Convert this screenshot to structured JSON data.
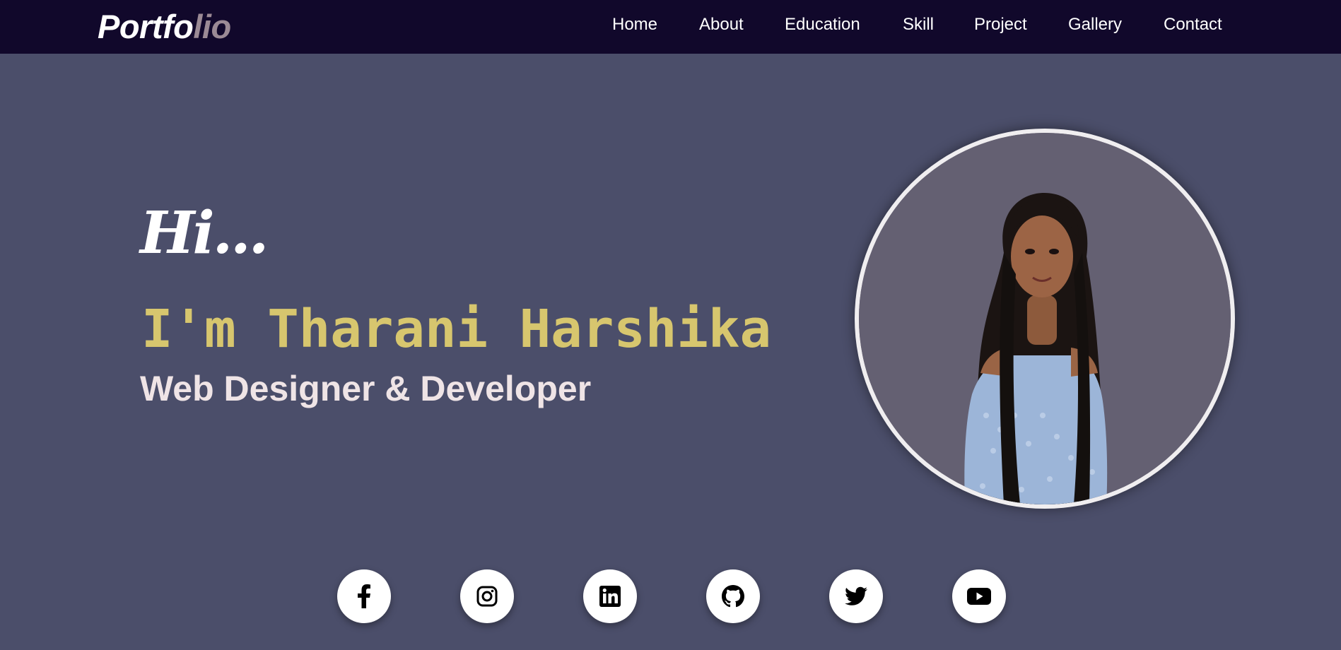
{
  "logo": {
    "part1": "Portfo",
    "part2": "lio"
  },
  "nav": {
    "items": [
      {
        "label": "Home"
      },
      {
        "label": "About"
      },
      {
        "label": "Education"
      },
      {
        "label": "Skill"
      },
      {
        "label": "Project"
      },
      {
        "label": "Gallery"
      },
      {
        "label": "Contact"
      }
    ]
  },
  "hero": {
    "greeting": "Hi...",
    "name": "I'm Tharani Harshika",
    "role": "Web Designer & Developer",
    "photo_icon": "profile-photo"
  },
  "social": [
    {
      "icon": "facebook-icon"
    },
    {
      "icon": "instagram-icon"
    },
    {
      "icon": "linkedin-icon"
    },
    {
      "icon": "github-icon"
    },
    {
      "icon": "twitter-icon"
    },
    {
      "icon": "youtube-icon"
    }
  ],
  "colors": {
    "navbar_bg": "#11082b",
    "page_bg": "#4b4e6a",
    "name_color": "#d7c66e",
    "logo_accent": "#9b8a95",
    "text_light": "#efe4e6"
  }
}
